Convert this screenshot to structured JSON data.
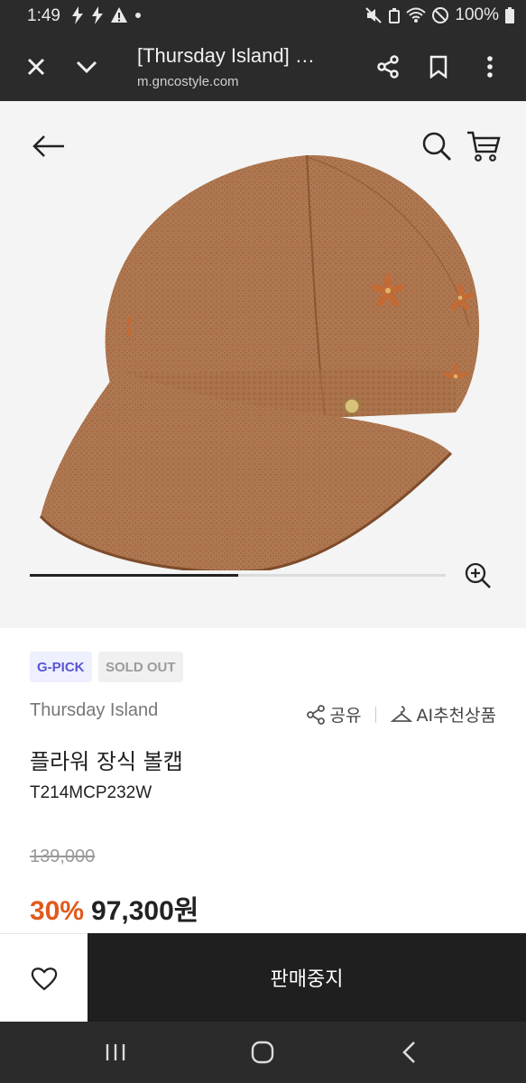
{
  "status_bar": {
    "time": "1:49",
    "battery": "100%"
  },
  "browser": {
    "title": "[Thursday Island] …",
    "url": "m.gncostyle.com"
  },
  "gallery": {
    "progress": 0.5
  },
  "product": {
    "badges": {
      "gpick": "G-PICK",
      "soldout": "SOLD OUT"
    },
    "brand": "Thursday Island",
    "share_label": "공유",
    "ai_label": "AI추천상품",
    "name": "플라워 장식 볼캡",
    "code": "T214MCP232W",
    "original_price": "139,000",
    "discount": "30%",
    "price": "97,300원"
  },
  "bottom": {
    "buy_label": "판매중지"
  },
  "colors": {
    "accent": "#e05a1c",
    "badge_text": "#5a55d6",
    "dark": "#1f1f1f"
  }
}
